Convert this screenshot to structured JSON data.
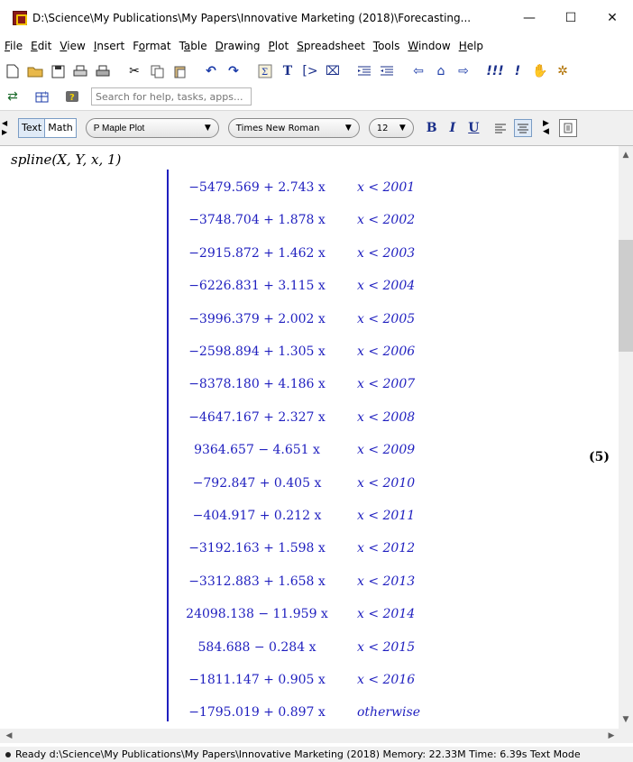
{
  "window": {
    "title": "D:\\Science\\My Publications\\My Papers\\Innovative Marketing (2018)\\Forecasting...",
    "controls": [
      "—",
      "☐",
      "✕"
    ]
  },
  "menu": [
    {
      "first": "F",
      "rest": "ile"
    },
    {
      "first": "E",
      "rest": "dit"
    },
    {
      "first": "V",
      "rest": "iew"
    },
    {
      "first": "I",
      "rest": "nsert"
    },
    {
      "pre": "F",
      "first": "o",
      "rest": "rmat"
    },
    {
      "pre": "T",
      "first": "a",
      "rest": "ble"
    },
    {
      "first": "D",
      "rest": "rawing"
    },
    {
      "first": "P",
      "rest": "lot"
    },
    {
      "first": "S",
      "rest": "preadsheet"
    },
    {
      "first": "T",
      "rest": "ools"
    },
    {
      "first": "W",
      "rest": "indow"
    },
    {
      "first": "H",
      "rest": "elp"
    }
  ],
  "toolbar": {
    "search_placeholder": "Search for help, tasks, apps..."
  },
  "context": {
    "mode_text": "Text",
    "mode_math": "Math",
    "style_label": "P  Maple Plot",
    "font_label": "Times New Roman",
    "size_label": "12",
    "bold": "B",
    "italic": "I",
    "underline": "U"
  },
  "document": {
    "input": "spline(X, Y, x, 1)",
    "equation_label": "(5)",
    "pieces": [
      {
        "expr": "−5479.569 + 2.743 x",
        "cond": "x < 2001"
      },
      {
        "expr": "−3748.704 + 1.878 x",
        "cond": "x < 2002"
      },
      {
        "expr": "−2915.872 + 1.462 x",
        "cond": "x < 2003"
      },
      {
        "expr": "−6226.831 + 3.115 x",
        "cond": "x < 2004"
      },
      {
        "expr": "−3996.379 + 2.002 x",
        "cond": "x < 2005"
      },
      {
        "expr": "−2598.894 + 1.305 x",
        "cond": "x < 2006"
      },
      {
        "expr": "−8378.180 + 4.186 x",
        "cond": "x < 2007"
      },
      {
        "expr": "−4647.167 + 2.327 x",
        "cond": "x < 2008"
      },
      {
        "expr": "9364.657 − 4.651 x",
        "cond": "x < 2009"
      },
      {
        "expr": "−792.847 + 0.405 x",
        "cond": "x < 2010"
      },
      {
        "expr": "−404.917 + 0.212 x",
        "cond": "x < 2011"
      },
      {
        "expr": "−3192.163 + 1.598 x",
        "cond": "x < 2012"
      },
      {
        "expr": "−3312.883 + 1.658 x",
        "cond": "x < 2013"
      },
      {
        "expr": "24098.138 − 11.959 x",
        "cond": "x < 2014"
      },
      {
        "expr": "584.688 − 0.284 x",
        "cond": "x < 2015"
      },
      {
        "expr": "−1811.147 + 0.905 x",
        "cond": "x < 2016"
      },
      {
        "expr": "−1795.019 + 0.897 x",
        "cond": "otherwise"
      }
    ]
  },
  "status": {
    "text": "Ready  d:\\Science\\My Publications\\My Papers\\Innovative Marketing (2018)   Memory: 22.33M   Time: 6.39s   Text Mode"
  }
}
